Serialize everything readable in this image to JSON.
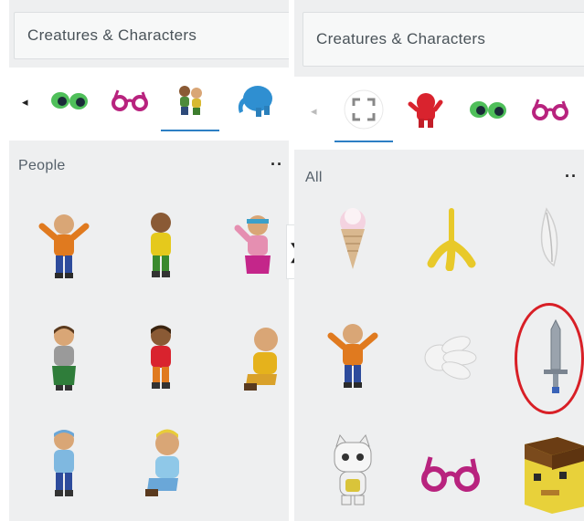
{
  "left_panel": {
    "dropdown_label": "Creatures & Characters",
    "section_title": "People",
    "more_label": "··",
    "scroll_left_glyph": "◂",
    "tabs": [
      {
        "icon": "eyes-icon"
      },
      {
        "icon": "glasses-icon"
      },
      {
        "icon": "people-icon",
        "active": true
      },
      {
        "icon": "elephant-icon"
      }
    ],
    "shapes": [
      {
        "icon": "person-orange-arms-up-icon"
      },
      {
        "icon": "person-yellow-icon"
      },
      {
        "icon": "person-pink-headband-icon"
      },
      {
        "icon": "person-green-skirt-icon"
      },
      {
        "icon": "person-red-icon"
      },
      {
        "icon": "person-sitting-yellow-icon"
      },
      {
        "icon": "person-blue-icon"
      },
      {
        "icon": "person-sitting-blue-icon"
      }
    ]
  },
  "collapse_glyph": "❯",
  "right_panel": {
    "dropdown_label": "Creatures & Characters",
    "section_title": "All",
    "more_label": "··",
    "scroll_left_glyph": "◂",
    "tabs": [
      {
        "icon": "all-frame-icon",
        "active": true
      },
      {
        "icon": "red-creature-icon"
      },
      {
        "icon": "eyes-icon"
      },
      {
        "icon": "glasses-icon"
      }
    ],
    "shapes": [
      {
        "icon": "ice-cream-icon"
      },
      {
        "icon": "banana-peel-icon"
      },
      {
        "icon": "feather-icon"
      },
      {
        "icon": "person-orange-arms-up-icon"
      },
      {
        "icon": "glove-hand-icon"
      },
      {
        "icon": "sword-icon",
        "highlighted": true
      },
      {
        "icon": "cat-character-icon"
      },
      {
        "icon": "glasses-icon"
      },
      {
        "icon": "block-head-icon"
      }
    ]
  },
  "colors": {
    "accent": "#2d7fc4",
    "highlight_ring": "#d81f26",
    "panel_bg": "#eeeff0"
  }
}
